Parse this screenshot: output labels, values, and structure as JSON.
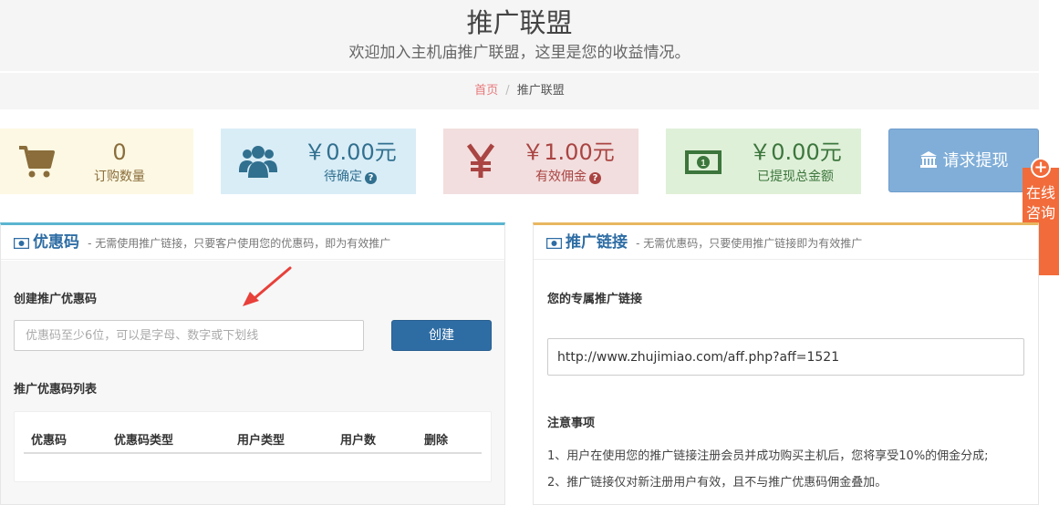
{
  "header": {
    "title": "推广联盟",
    "subtitle": "欢迎加入主机庙推广联盟，这里是您的收益情况。"
  },
  "breadcrumb": {
    "home": "首页",
    "separator": "/",
    "current": "推广联盟"
  },
  "stats": {
    "orders": {
      "value": "0",
      "label": "订购数量",
      "icon": "cart-icon"
    },
    "pending": {
      "value": "￥0.00元",
      "label": "待确定",
      "icon": "users-icon"
    },
    "valid": {
      "value": "￥1.00元",
      "label": "有效佣金",
      "icon": "yen-icon"
    },
    "withdrawn": {
      "value": "￥0.00元",
      "label": "已提现总金额",
      "icon": "money-icon"
    }
  },
  "withdraw_button": {
    "label": "请求提现",
    "icon": "bank-icon"
  },
  "side_float": {
    "label": "在线咨询",
    "icon": "plus-circle-icon"
  },
  "coupon_panel": {
    "title": "优惠码",
    "description": "- 无需使用推广链接，只要客户使用您的优惠码，即为有效推广",
    "create_label": "创建推广优惠码",
    "input_placeholder": "优惠码至少6位，可以是字母、数字或下划线",
    "create_button": "创建",
    "list_label": "推广优惠码列表",
    "table_headers": [
      "优惠码",
      "优惠码类型",
      "用户类型",
      "用户数",
      "删除"
    ]
  },
  "link_panel": {
    "title": "推广链接",
    "description": "- 无需优惠码，只要使用推广链接即为有效推广",
    "link_label": "您的专属推广链接",
    "link_value": "http://www.zhujimiao.com/aff.php?aff=1521",
    "notes_title": "注意事项",
    "notes": [
      "1、用户在使用您的推广链接注册会员并成功购买主机后，您将享受10%的佣金分成;",
      "2、推广链接仅对新注册用户有效，且不与推广优惠码佣金叠加。"
    ]
  },
  "colors": {
    "primary": "#2e6da4",
    "orders_bg": "#fcf8e3",
    "pending_bg": "#d9edf7",
    "valid_bg": "#f2dede",
    "withdrawn_bg": "#dff0d8",
    "withdraw_btn": "#80aed8",
    "float": "#f26b3a",
    "arrow": "#e8403a"
  }
}
